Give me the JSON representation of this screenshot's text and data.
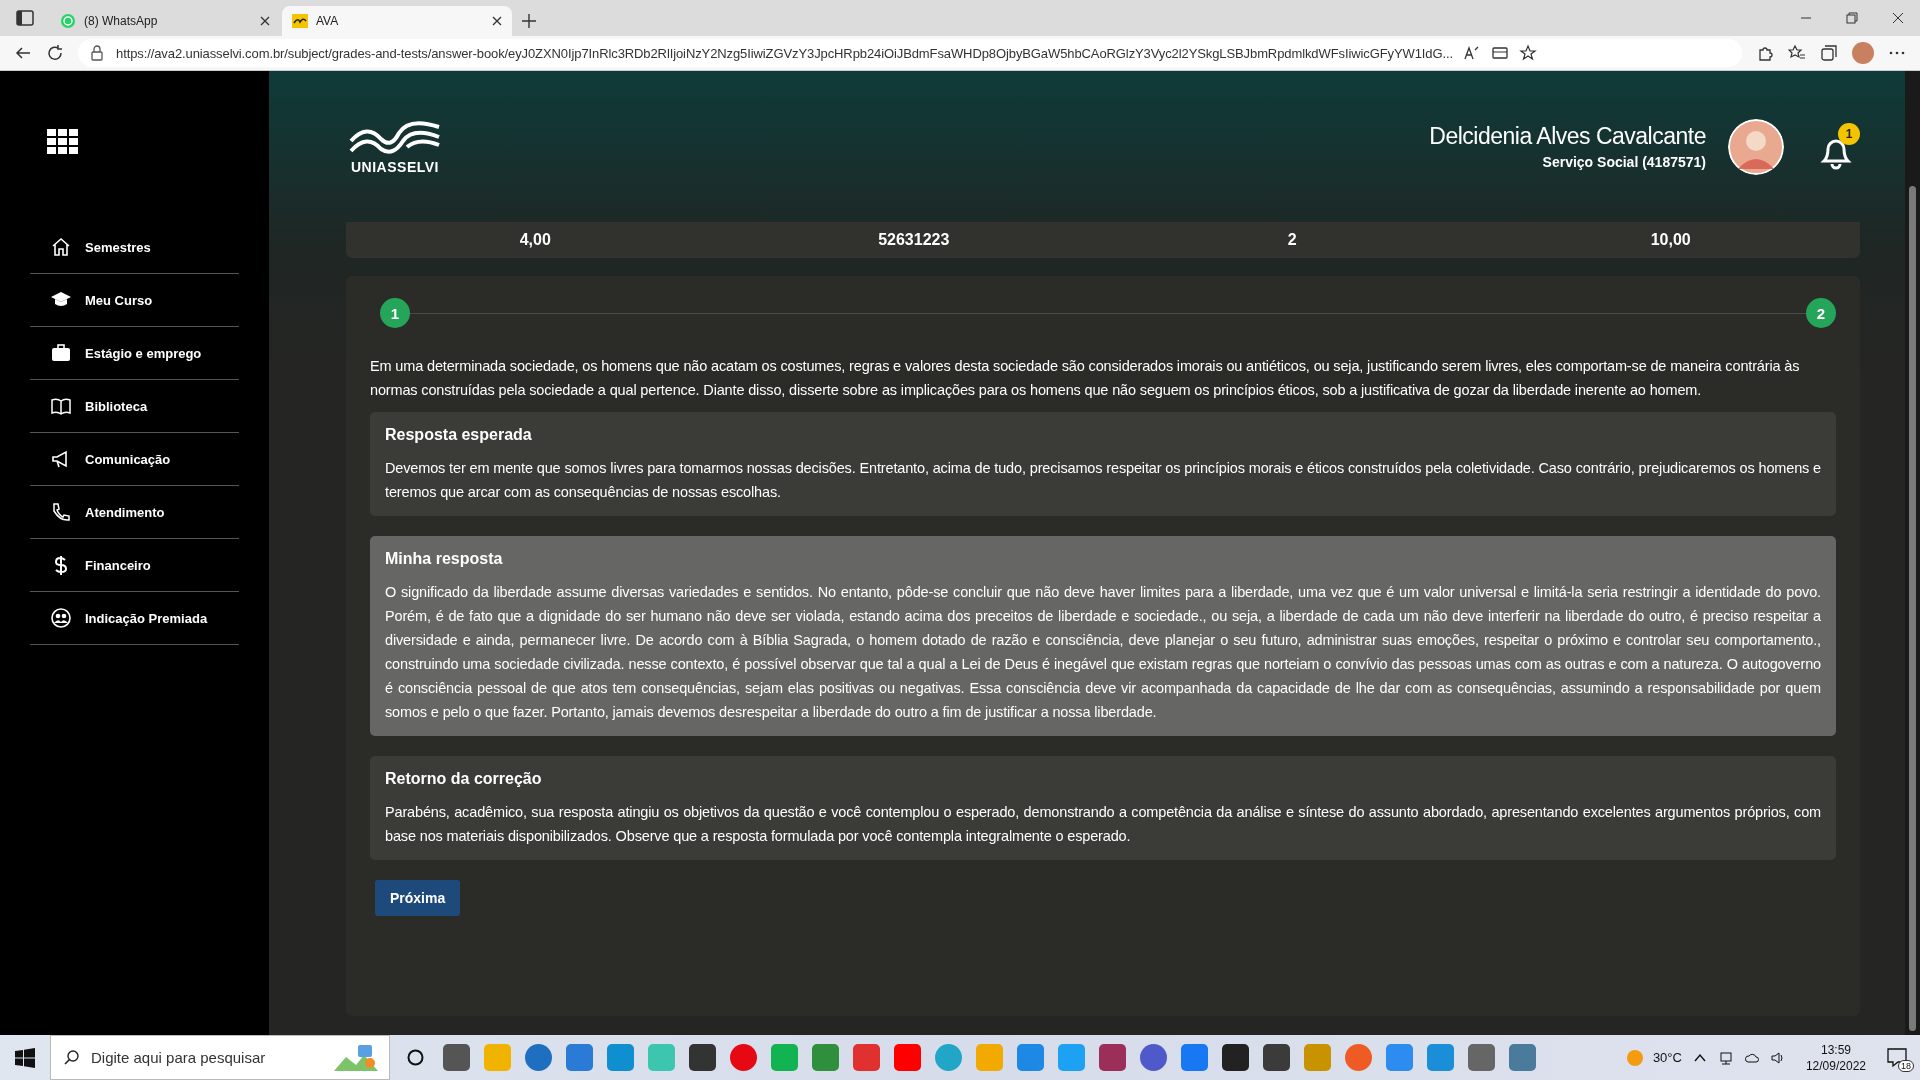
{
  "browser": {
    "tabs": [
      {
        "title": "(8) WhatsApp",
        "selected": false
      },
      {
        "title": "AVA",
        "selected": true
      }
    ],
    "url": "https://ava2.uniasselvi.com.br/subject/grades-and-tests/answer-book/eyJ0ZXN0Ijp7InRlc3RDb2RlIjoiNzY2Nzg5IiwiZGVzY3JpcHRpb24iOiJBdmFsaWHDp8OjbyBGaW5hbCAoRGlzY3Vyc2l2YSkgLSBJbmRpdmlkdWFsIiwicGFyYW1IdG..."
  },
  "sidebar": {
    "items": [
      {
        "label": "Semestres"
      },
      {
        "label": "Meu Curso"
      },
      {
        "label": "Estágio e emprego"
      },
      {
        "label": "Biblioteca"
      },
      {
        "label": "Comunicação"
      },
      {
        "label": "Atendimento"
      },
      {
        "label": "Financeiro"
      },
      {
        "label": "Indicação Premiada"
      }
    ]
  },
  "header": {
    "logo_text": "UNIASSELVI",
    "user_name": "Delcidenia Alves Cavalcante",
    "course": "Serviço Social (4187571)",
    "notification_count": "1"
  },
  "summary_row": [
    "4,00",
    "52631223",
    "2",
    "10,00"
  ],
  "steps": [
    "1",
    "2"
  ],
  "question": "Em uma determinada sociedade, os homens que não acatam os costumes, regras e valores desta sociedade são considerados imorais ou antiéticos, ou seja, justificando serem livres, eles comportam-se de maneira contrária às normas construídas pela sociedade a qual pertence. Diante disso, disserte sobre as implicações para os homens que não seguem os princípios éticos, sob a justificativa de gozar da liberdade inerente ao homem.",
  "sections": [
    {
      "title": "Resposta esperada",
      "highlighted": false,
      "body": "Devemos ter em mente que somos livres para tomarmos nossas decisões. Entretanto, acima de tudo, precisamos respeitar os princípios morais e éticos construídos pela coletividade. Caso contrário, prejudicaremos os homens e teremos que arcar com as consequências de nossas escolhas."
    },
    {
      "title": "Minha resposta",
      "highlighted": true,
      "body": "O significado da liberdade assume diversas variedades e sentidos. No entanto, pôde-se concluir que não deve haver limites para a liberdade, uma vez que é um valor universal e limitá-la seria restringir a identidade do povo. Porém, é de fato que a dignidade do ser humano não deve ser violada, estando acima dos preceitos de liberdade e sociedade., ou seja, a liberdade de cada um não deve interferir na liberdade do outro, é preciso respeitar a diversidade e ainda, permanecer livre. De acordo com à Bíblia Sagrada, o homem dotado de razão e consciência, deve planejar o seu futuro, administrar suas emoções, respeitar o próximo e controlar seu comportamento., construindo uma sociedade civilizada. nesse contexto, é possível observar que tal a qual a Lei de Deus é inegável que existam regras que norteiam o convívio das pessoas umas com as outras e com a natureza. O autogoverno é consciência pessoal de que atos tem consequências, sejam elas positivas ou negativas. Essa consciência deve vir acompanhada da capacidade de lhe dar com as consequências, assumindo a responsabilidade por quem somos e pelo o que fazer. Portanto, jamais devemos desrespeitar a liberdade do outro a fim de justificar a nossa liberdade."
    },
    {
      "title": "Retorno da correção",
      "highlighted": false,
      "body": "Parabéns, acadêmico, sua resposta atingiu os objetivos da questão e você contemplou o esperado, demonstrando a competência da análise e síntese do assunto abordado, apresentando excelentes argumentos próprios, com base nos materiais disponibilizados. Observe que a resposta formulada por você contempla integralmente o esperado."
    }
  ],
  "next_button": "Próxima",
  "taskbar": {
    "search_placeholder": "Digite aqui para pesquisar",
    "temperature": "30°C",
    "time": "13:59",
    "date": "12/09/2022",
    "notification_count": "18"
  }
}
